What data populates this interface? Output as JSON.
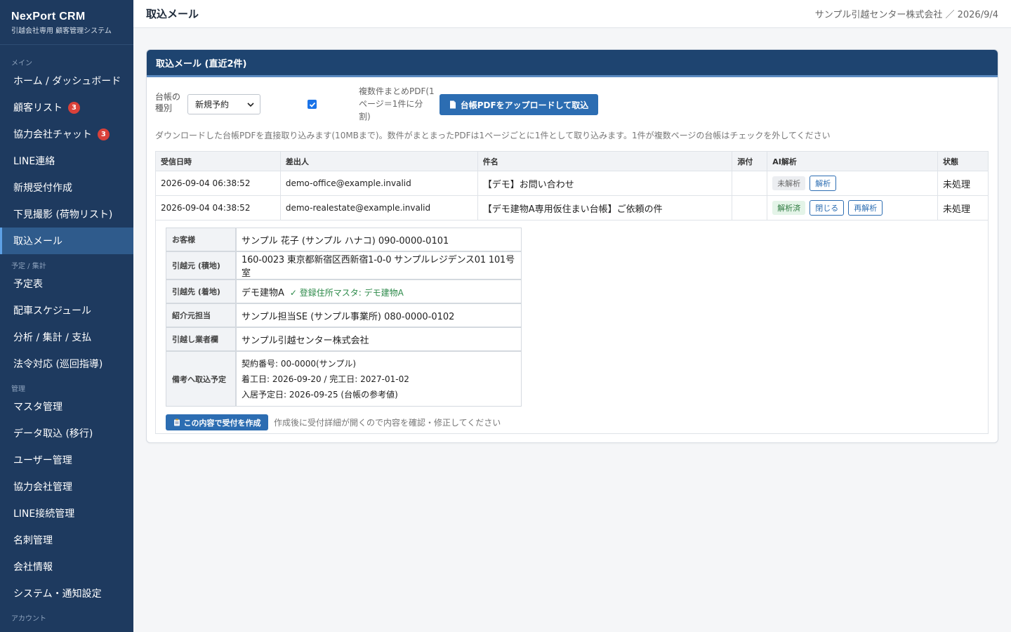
{
  "app": {
    "brand_title": "NexPort CRM",
    "brand_subtitle": "引越会社専用 顧客管理システム"
  },
  "sidebar": {
    "sections": {
      "main": "メイン",
      "schedule": "予定 / 集計",
      "admin": "管理",
      "account": "アカウント"
    },
    "items": [
      {
        "label": "ホーム / ダッシュボード"
      },
      {
        "label": "顧客リスト",
        "badge": "3"
      },
      {
        "label": "協力会社チャット",
        "badge": "3"
      },
      {
        "label": "LINE連絡"
      },
      {
        "label": "新規受付作成"
      },
      {
        "label": "下見撮影 (荷物リスト)"
      },
      {
        "label": "取込メール",
        "active": true
      },
      {
        "label": "予定表"
      },
      {
        "label": "配車スケジュール"
      },
      {
        "label": "分析 / 集計 / 支払"
      },
      {
        "label": "法令対応 (巡回指導)"
      },
      {
        "label": "マスタ管理"
      },
      {
        "label": "データ取込 (移行)"
      },
      {
        "label": "ユーザー管理"
      },
      {
        "label": "協力会社管理"
      },
      {
        "label": "LINE接続管理"
      },
      {
        "label": "名刺管理"
      },
      {
        "label": "会社情報"
      },
      {
        "label": "システム・通知設定"
      }
    ]
  },
  "topbar": {
    "title": "取込メール",
    "company_date": "サンプル引越センター株式会社 ／ 2026/9/4"
  },
  "card": {
    "title": "取込メール (直近2件)",
    "ledger_label": "台帳の種別",
    "ledger_select": "新規予約",
    "multi_pdf_label": "複数件まとめPDF(1ページ＝1件に分割)",
    "multi_pdf_checked": true,
    "upload_button": "台帳PDFをアップロードして取込",
    "hint": "ダウンロードした台帳PDFを直接取り込みます(10MBまで)。数件がまとまったPDFは1ページごとに1件として取り込みます。1件が複数ページの台帳はチェックを外してください"
  },
  "table": {
    "headers": [
      "受信日時",
      "差出人",
      "件名",
      "添付",
      "AI解析",
      "状態"
    ],
    "rows": [
      {
        "received": "2026-09-04 06:38:52",
        "sender": "demo-office@example.invalid",
        "subject": "【デモ】お問い合わせ",
        "attachment": "",
        "ai_status": "未解析",
        "ai_button": "解析",
        "status": "未処理"
      },
      {
        "received": "2026-09-04 04:38:52",
        "sender": "demo-realestate@example.invalid",
        "subject": "【デモ建物A専用仮住まい台帳】ご依頼の件",
        "attachment": "",
        "ai_status": "解析済",
        "ai_close_button": "閉じる",
        "ai_reanalyze_button": "再解析",
        "status": "未処理"
      }
    ]
  },
  "detail": {
    "rows": [
      {
        "label": "お客様",
        "value": "サンプル 花子 (サンプル ハナコ) 090-0000-0101"
      },
      {
        "label": "引越元 (積地)",
        "value": "160-0023 東京都新宿区西新宿1-0-0 サンプルレジデンス01 101号室"
      },
      {
        "label": "引越先 (着地)",
        "value": "デモ建物A",
        "note": "✓ 登録住所マスタ: デモ建物A"
      },
      {
        "label": "紹介元担当",
        "value": "サンプル担当SE (サンプル事業所) 080-0000-0102"
      },
      {
        "label": "引越し業者欄",
        "value": "サンプル引越センター株式会社"
      }
    ],
    "notes_label": "備考へ取込予定",
    "notes_lines": [
      "契約番号: 00-0000(サンプル)",
      "着工日: 2026-09-20 / 完工日: 2027-01-02",
      "入居予定日: 2026-09-25 (台帳の参考値)"
    ],
    "create_button": "この内容で受付を作成",
    "create_note": "作成後に受付詳細が開くので内容を確認・修正してください"
  },
  "colors": {
    "sidebar_bg": "#1e3a5f",
    "accent": "#2c6db2",
    "card_header": "#1e4470",
    "badge": "#d9413a"
  }
}
